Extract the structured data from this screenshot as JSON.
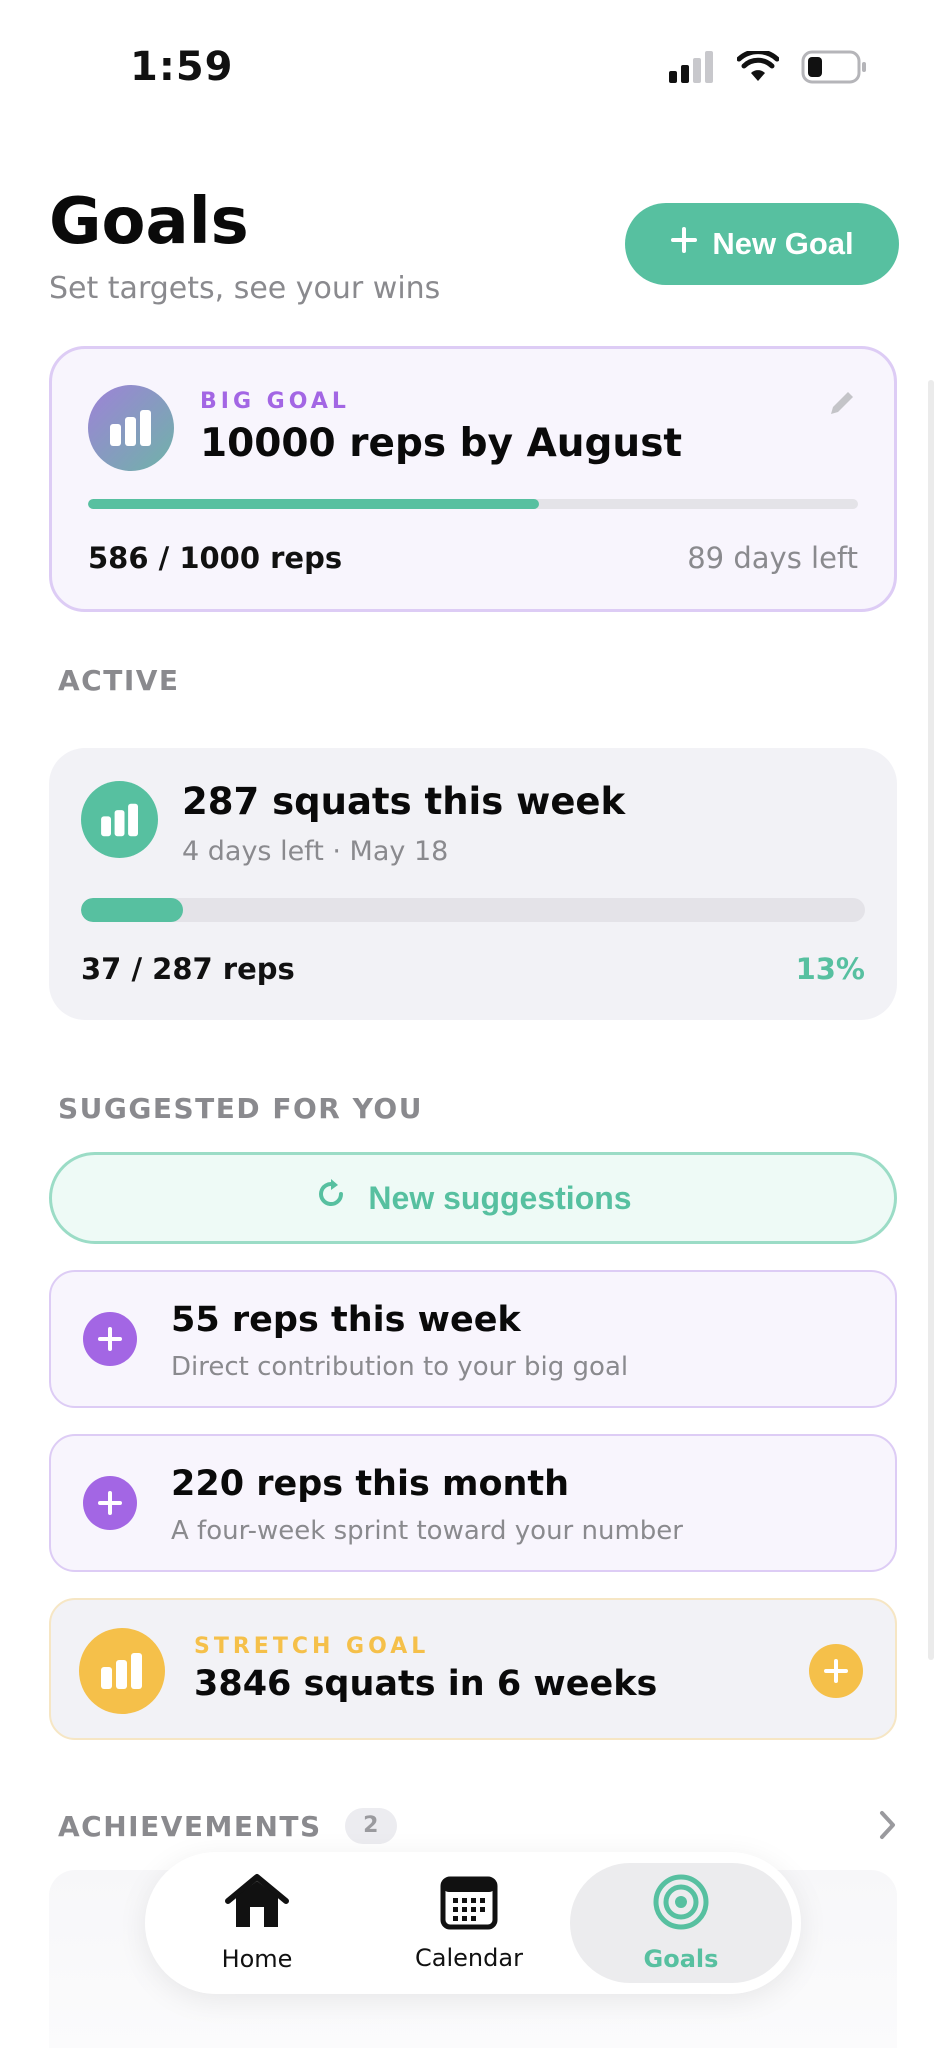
{
  "status_bar": {
    "time": "1:59"
  },
  "header": {
    "title": "Goals",
    "subtitle": "Set targets, see your wins",
    "new_goal_label": "New Goal"
  },
  "big_goal": {
    "kicker": "BIG GOAL",
    "title": "10000 reps by August",
    "progress_text": "586 / 1000 reps",
    "progress_fraction": 0.586,
    "days_left": "89 days left"
  },
  "active_section": {
    "label": "ACTIVE",
    "goal": {
      "title": "287 squats this week",
      "meta": "4 days left · May 18",
      "progress_text": "37 / 287 reps",
      "percent": "13%",
      "progress_fraction": 0.13
    }
  },
  "suggested_section": {
    "label": "SUGGESTED FOR YOU",
    "refresh_label": "New suggestions",
    "items": [
      {
        "title": "55 reps this week",
        "description": "Direct contribution to your big goal"
      },
      {
        "title": "220 reps this month",
        "description": "A four-week sprint toward your number"
      }
    ],
    "stretch": {
      "kicker": "STRETCH GOAL",
      "title": "3846 squats in 6 weeks"
    }
  },
  "achievements": {
    "label": "ACHIEVEMENTS",
    "count": "2"
  },
  "tab_bar": {
    "home": "Home",
    "calendar": "Calendar",
    "goals": "Goals"
  },
  "colors": {
    "accent_green": "#57c0a0",
    "purple": "#a366e4",
    "gold": "#f5c04a"
  }
}
